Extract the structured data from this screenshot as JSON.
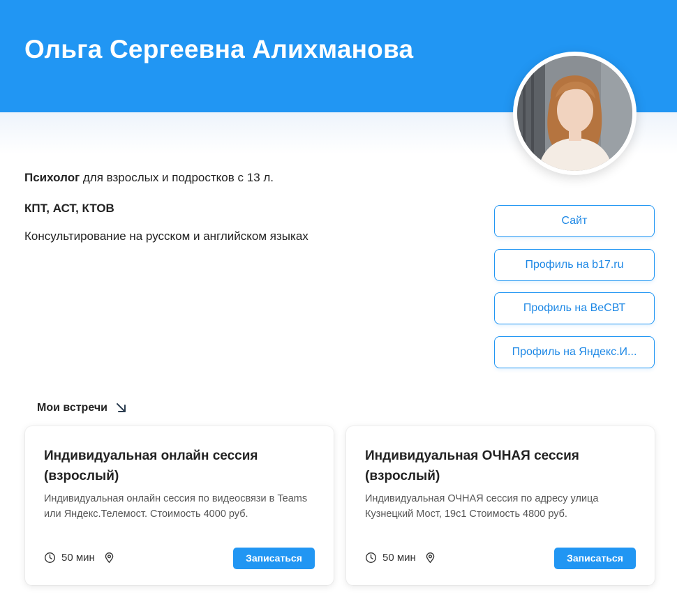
{
  "profile": {
    "name": "Ольга Сергеевна Алихманова",
    "role_bold": "Психолог",
    "role_rest": " для взрослых и подростков с 13 л.",
    "methods": "КПТ, АСТ, КТОВ",
    "languages": "Консультирование на русском и английском языках"
  },
  "links": [
    {
      "label": "Сайт"
    },
    {
      "label": "Профиль на b17.ru"
    },
    {
      "label": "Профиль на ВеСВТ"
    },
    {
      "label": "Профиль на Яндекс.И..."
    }
  ],
  "meetings": {
    "title": "Мои встречи",
    "cards": [
      {
        "title": "Индивидуальная онлайн сессия (взрослый)",
        "description": "Индивидуальная онлайн сессия по видеосвязи в Teams или Яндекс.Телемост. Стоимость 4000 руб.",
        "duration": "50 мин",
        "button": "Записаться"
      },
      {
        "title": "Индивидуальная ОЧНАЯ сессия (взрослый)",
        "description": "Индивидуальная ОЧНАЯ сессия по адресу улица Кузнецкий Мост, 19с1 Стоимость 4800 руб.",
        "duration": "50 мин",
        "button": "Записаться"
      }
    ]
  },
  "colors": {
    "accent": "#2196f3",
    "header_bg": "#2196f3"
  },
  "icons": [
    "arrow-down-right-icon",
    "clock-icon",
    "location-pin-icon"
  ]
}
